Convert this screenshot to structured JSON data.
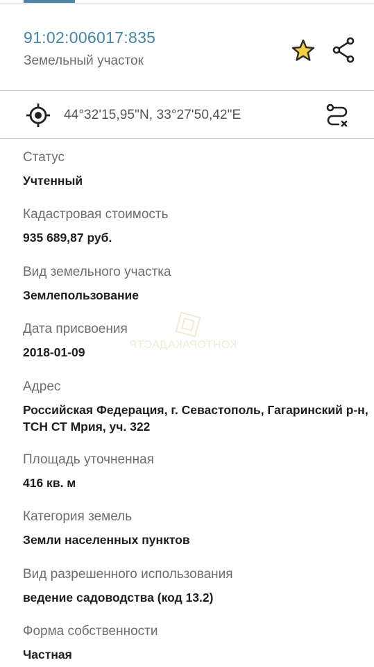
{
  "object": {
    "cadastral_number": "91:02:006017:835",
    "type": "Земельный участок"
  },
  "coordinates": "44°32'15,95\"N, 33°27'50,42\"E",
  "fields": [
    {
      "label": "Статус",
      "value": "Учтенный"
    },
    {
      "label": "Кадастровая стоимость",
      "value": "935 689,87 руб."
    },
    {
      "label": "Вид земельного участка",
      "value": "Землепользование"
    },
    {
      "label": "Дата присвоения",
      "value": "2018-01-09"
    },
    {
      "label": "Адрес",
      "value": "Российская Федерация, г. Севастополь, Гагаринский р-н, ТСН СТ Мрия, уч. 322"
    },
    {
      "label": "Площадь уточненная",
      "value": "416 кв. м"
    },
    {
      "label": "Категория земель",
      "value": "Земли населенных пунктов"
    },
    {
      "label": "Вид разрешенного использования",
      "value": "ведение садоводства (код 13.2)"
    },
    {
      "label": "Форма собственности",
      "value": "Частная"
    }
  ],
  "watermark": {
    "text": "КОНТОРАКАДАСТР"
  },
  "icons": {
    "star": "star-icon",
    "share": "share-icon",
    "locate": "crosshair-icon",
    "route": "route-icon"
  },
  "colors": {
    "accent": "#3f84ad",
    "star_fill": "#f2d23a",
    "star_stroke": "#2b2b2b"
  }
}
